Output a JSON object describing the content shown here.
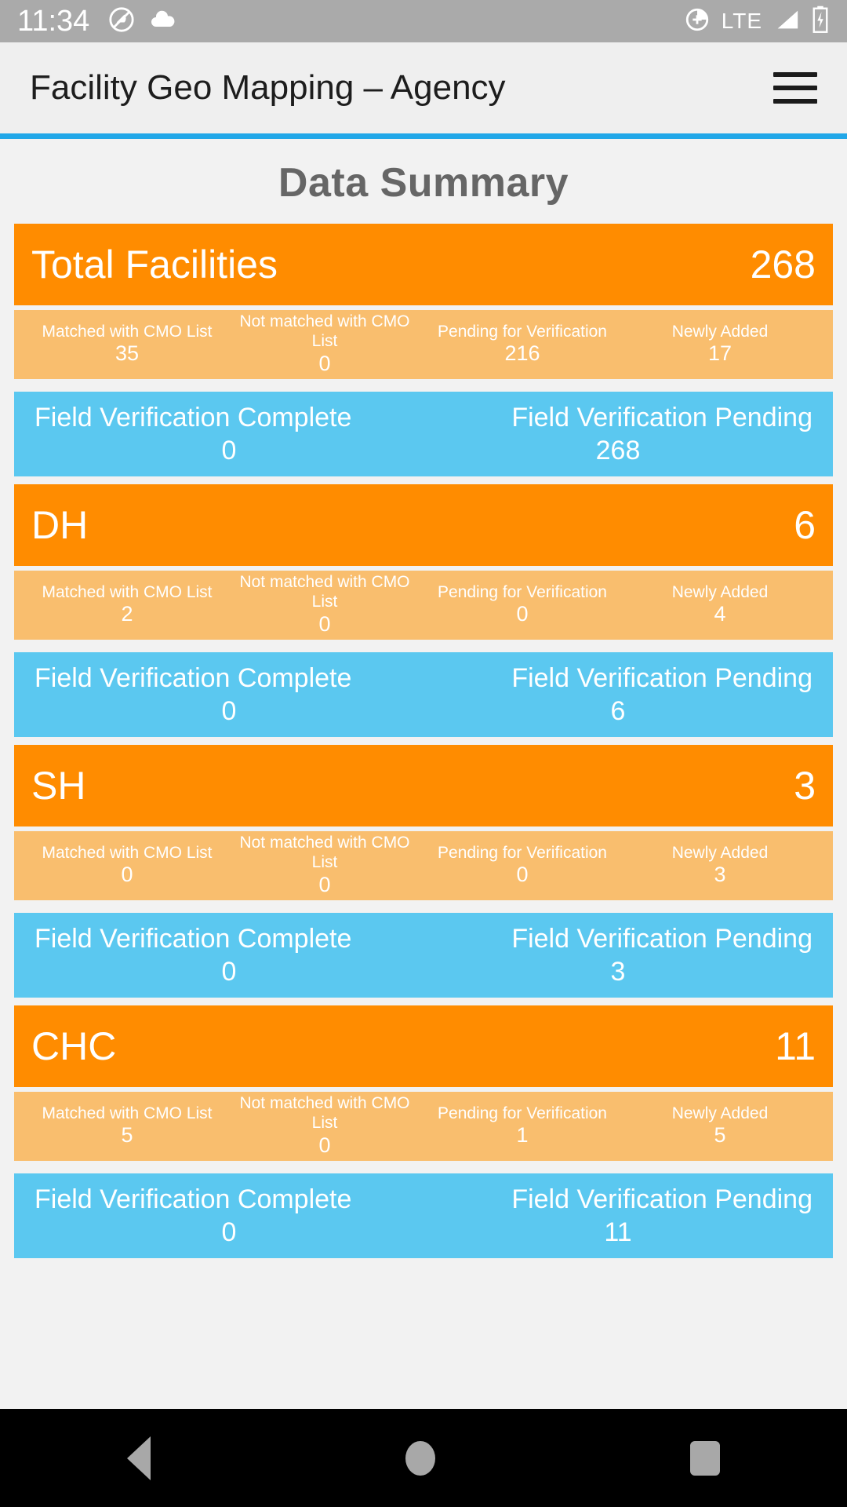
{
  "status_bar": {
    "time": "11:34",
    "network_type": "LTE",
    "icons": [
      "do-not-disturb-icon",
      "cloud-icon",
      "location-icon",
      "signal-icon",
      "battery-charging-icon"
    ]
  },
  "app_bar": {
    "title": "Facility Geo Mapping – Agency",
    "menu_icon": "hamburger-menu-icon",
    "accent_color": "#21a7e8"
  },
  "page": {
    "title": "Data Summary"
  },
  "labels": {
    "matched": "Matched with CMO List",
    "not_matched": "Not matched with CMO List",
    "pending": "Pending for Verification",
    "newly_added": "Newly Added",
    "fv_complete": "Field Verification Complete",
    "fv_pending": "Field Verification Pending"
  },
  "colors": {
    "header_orange": "#ff8c00",
    "stats_orange": "#f9be6e",
    "field_blue": "#5bc8f0",
    "page_bg": "#f2f2f2",
    "appbar_bg": "#efefef",
    "statusbar_bg": "#aaaaaa"
  },
  "groups": [
    {
      "name": "Total Facilities",
      "count": "268",
      "matched": "35",
      "not_matched": "0",
      "pending": "216",
      "newly_added": "17",
      "fv_complete": "0",
      "fv_pending": "268"
    },
    {
      "name": "DH",
      "count": "6",
      "matched": "2",
      "not_matched": "0",
      "pending": "0",
      "newly_added": "4",
      "fv_complete": "0",
      "fv_pending": "6"
    },
    {
      "name": "SH",
      "count": "3",
      "matched": "0",
      "not_matched": "0",
      "pending": "0",
      "newly_added": "3",
      "fv_complete": "0",
      "fv_pending": "3"
    },
    {
      "name": "CHC",
      "count": "11",
      "matched": "5",
      "not_matched": "0",
      "pending": "1",
      "newly_added": "5",
      "fv_complete": "0",
      "fv_pending": "11"
    }
  ],
  "nav_bar": {
    "back": "back-icon",
    "home": "home-icon",
    "recents": "recents-icon"
  }
}
